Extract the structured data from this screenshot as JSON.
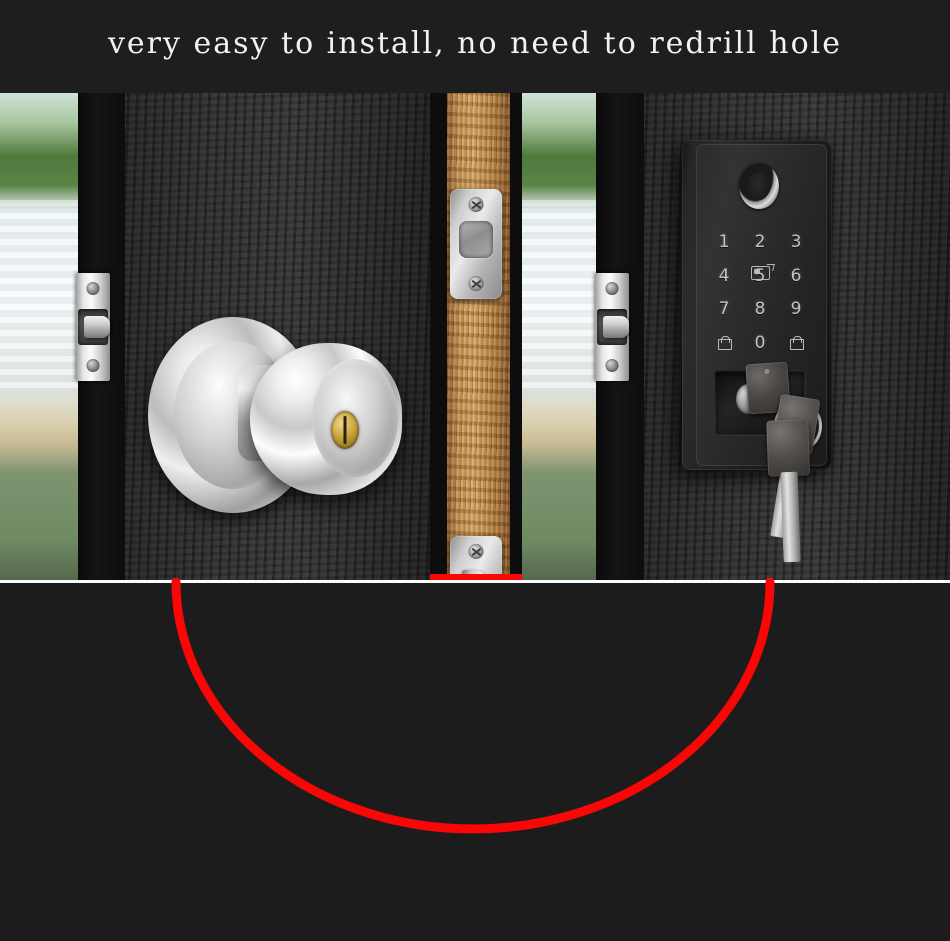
{
  "headline": {
    "text": "very easy to install, no need to redrill hole"
  },
  "colors": {
    "background": "#1e1e1e",
    "headline_text": "#f2f2f2",
    "accent_red": "#f90606",
    "divider_white": "#fbfbfb",
    "wood": "#c79456",
    "metal": "#d6d6d6",
    "brass": "#c8a43c"
  },
  "panels": {
    "left": {
      "name": "knob-lock-interior-view",
      "scene": "dark wood door with chrome knob lock",
      "elements": [
        {
          "name": "window-view",
          "label": "outdoor window view"
        },
        {
          "name": "door-jamb",
          "label": "door jamb"
        },
        {
          "name": "strike-plate",
          "label": "strike plate with latch bolt"
        },
        {
          "name": "door-knob",
          "label": "chrome round knob"
        },
        {
          "name": "key-cylinder",
          "label": "brass key cylinder"
        }
      ]
    },
    "middle": {
      "name": "door-edge-view",
      "scene": "wooden door edge showing existing bore holes",
      "elements": [
        {
          "name": "wood-edge",
          "label": "wooden door edge"
        },
        {
          "name": "deadbolt-faceplate",
          "label": "upper faceplate with square deadbolt"
        },
        {
          "name": "latch-faceplate",
          "label": "lower faceplate with D-shaped latch"
        }
      ]
    },
    "right": {
      "name": "smart-lock-installed-view",
      "scene": "same door fitted with keypad smart lock",
      "elements": [
        {
          "name": "window-view",
          "label": "outdoor window view"
        },
        {
          "name": "strike-plate",
          "label": "strike plate with latch bolt"
        },
        {
          "name": "smart-lock-body",
          "label": "black keypad smart lock"
        },
        {
          "name": "fingerprint-reader",
          "label": "fingerprint reader ring"
        },
        {
          "name": "key-override-cylinder",
          "label": "mechanical key override with keys"
        }
      ]
    }
  },
  "keypad": {
    "rows": [
      [
        "1",
        "2",
        "3"
      ],
      [
        "4",
        "5",
        "6"
      ],
      [
        "7",
        "8",
        "9"
      ],
      [
        "lock",
        "0",
        "lock"
      ]
    ],
    "card_icon": "rfid-card-icon",
    "fingerprint_icon": "fingerprint-icon",
    "digits": [
      "1",
      "2",
      "3",
      "4",
      "5",
      "6",
      "7",
      "8",
      "9",
      "0"
    ]
  },
  "annotation": {
    "arc": {
      "name": "red-highlight-arc",
      "color": "#f90606",
      "shape": "semicircle"
    },
    "marker": {
      "name": "red-edge-marker",
      "color": "#f90606"
    }
  }
}
